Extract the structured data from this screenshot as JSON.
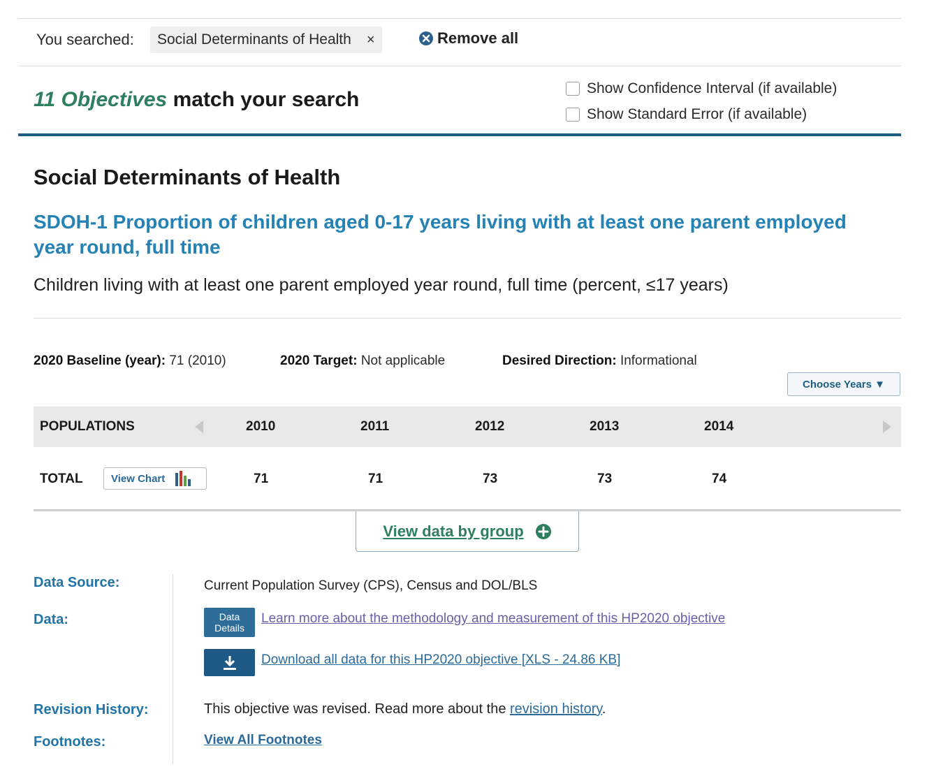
{
  "search": {
    "label": "You searched:",
    "chip": "Social Determinants of Health",
    "chip_remove": "×",
    "remove_all": "Remove all"
  },
  "results": {
    "count_text": "11 Objectives",
    "suffix": "match your search"
  },
  "options": {
    "confidence": {
      "label": "Show Confidence Interval (if available)",
      "checked": false
    },
    "std_error": {
      "label": "Show Standard Error (if available)",
      "checked": false
    }
  },
  "section_title": "Social Determinants of Health",
  "objective": {
    "title": "SDOH-1 Proportion of children aged 0-17 years living with at least one parent employed year round, full time",
    "description": "Children living with at least one parent employed year round, full time (percent, ≤17 years)"
  },
  "meta": {
    "baseline_label": "2020 Baseline (year):",
    "baseline_value": "71 (2010)",
    "target_label": "2020 Target:",
    "target_value": "Not applicable",
    "direction_label": "Desired Direction:",
    "direction_value": "Informational"
  },
  "choose_years": "Choose Years ▼",
  "table": {
    "header": "POPULATIONS",
    "years": [
      "2010",
      "2011",
      "2012",
      "2013",
      "2014"
    ],
    "row_label": "TOTAL",
    "view_chart": "View Chart",
    "values": [
      "71",
      "71",
      "73",
      "73",
      "74"
    ]
  },
  "view_data_by_group": "View data by group",
  "details": {
    "source_label": "Data Source:",
    "source_value": "Current Population Survey (CPS), Census and DOL/BLS",
    "data_label": "Data:",
    "data_details_btn": "Data Details",
    "methodology_link": "Learn more about the methodology and measurement of this HP2020 objective",
    "download_link": "Download all data for this HP2020 objective [XLS - 24.86 KB]",
    "revision_label": "Revision History:",
    "revision_text": "This objective was revised. Read more about the",
    "revision_link": "revision history",
    "revision_end": ".",
    "footnotes_label": "Footnotes:",
    "footnotes_link": "View All Footnotes"
  },
  "colors": {
    "accent_green": "#2e7f5e",
    "title_blue": "#2582b5",
    "rule_blue": "#1d5f84",
    "label_blue": "#2174a8"
  }
}
